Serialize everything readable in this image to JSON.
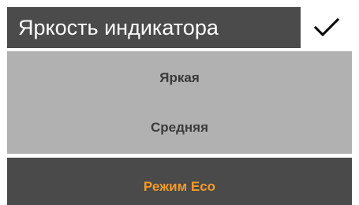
{
  "header": {
    "title": "Яркость индикатора",
    "confirm_icon": "checkmark-icon"
  },
  "options": [
    {
      "label": "Яркая",
      "selected": false
    },
    {
      "label": "Средняя",
      "selected": false
    },
    {
      "label": "Режим Eco",
      "selected": true
    }
  ],
  "colors": {
    "header_background": "#4b4b4b",
    "options_background": "#b1b1b1",
    "selected_background": "#4a4a4a",
    "selected_text": "#f39a2b",
    "option_text": "#3b3b3b"
  }
}
